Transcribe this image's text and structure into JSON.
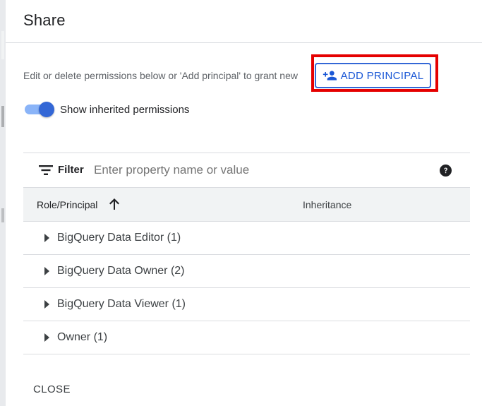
{
  "dialog": {
    "title": "Share",
    "description": "Edit or delete permissions below or 'Add principal' to grant new",
    "add_principal_label": "ADD PRINCIPAL",
    "toggle": {
      "label": "Show inherited permissions",
      "checked": true
    },
    "filter": {
      "label": "Filter",
      "placeholder": "Enter property name or value",
      "value": ""
    },
    "table": {
      "columns": [
        "Role/Principal",
        "Inheritance"
      ],
      "sort": "ascending",
      "rows": [
        {
          "label": "BigQuery Data Editor (1)"
        },
        {
          "label": "BigQuery Data Owner (2)"
        },
        {
          "label": "BigQuery Data Viewer (1)"
        },
        {
          "label": "Owner (1)"
        }
      ]
    },
    "close_label": "CLOSE"
  },
  "colors": {
    "accent": "#3367d6",
    "highlight": "#e50000",
    "header_bg": "#f1f3f4",
    "divider": "#dadce0"
  },
  "icons": [
    "person-add-icon",
    "filter-list-icon",
    "help-icon",
    "arrow-upward-icon",
    "caret-right-icon"
  ]
}
